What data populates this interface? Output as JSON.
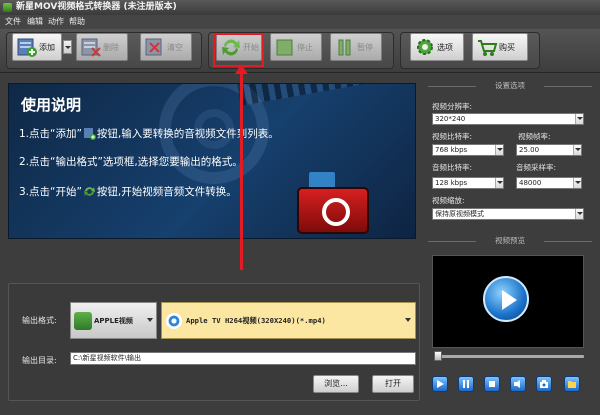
{
  "window": {
    "title": "新星MOV视频格式转换器 (未注册版本)"
  },
  "menu": [
    "文件",
    "编辑",
    "动作",
    "帮助"
  ],
  "toolbar": {
    "add": "添加",
    "delete": "删除",
    "clear": "清空",
    "start": "开始",
    "stop": "停止",
    "pause": "暂停",
    "options": "选项",
    "buy": "购买"
  },
  "banner": {
    "title": "使用说明",
    "step1_a": "1.点击“添加”",
    "step1_b": "按钮,输入要转换的音视频文件到列表。",
    "step2": "2.点击“输出格式”选项框,选择您要输出的格式。",
    "step3_a": "3.点击“开始”",
    "step3_b": "按钮,开始视频音频文件转换。"
  },
  "output": {
    "format_label": "输出格式:",
    "category": "APPLE视频",
    "format": "Apple TV H264视频(320X240)(*.mp4)",
    "dir_label": "输出目录:",
    "dir_value": "C:\\新星视频软件\\输出",
    "browse": "浏览...",
    "open": "打开"
  },
  "settings": {
    "header": "设置选项",
    "resolution_label": "视频分辨率:",
    "resolution": "320*240",
    "vbitrate_label": "视频比特率:",
    "vbitrate": "768 kbps",
    "fps_label": "视频帧率:",
    "fps": "25.00",
    "abitrate_label": "音频比特率:",
    "abitrate": "128 kbps",
    "samplerate_label": "音频采样率:",
    "samplerate": "48000",
    "zoom_label": "视频缩放:",
    "zoom": "保持原视频模式"
  },
  "preview": {
    "header": "视频预览"
  },
  "colors": {
    "highlight": "#e31b23",
    "format_bg": "#fbe7a1"
  }
}
